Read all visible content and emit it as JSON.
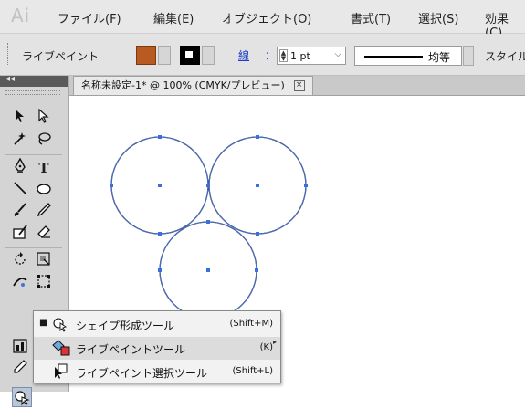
{
  "app": {
    "logo": "Ai"
  },
  "menu": [
    "ファイル(F)",
    "編集(E)",
    "オブジェクト(O)",
    "書式(T)",
    "選択(S)",
    "効果(C)"
  ],
  "control_bar": {
    "label": "ライブペイント",
    "fill_color": "#b85a22",
    "stroke_link": "線",
    "stroke_colon": "：",
    "stroke_weight": "1 pt",
    "profile_label": "均等",
    "style_label": "スタイル"
  },
  "document": {
    "tab_title": "名称未設定-1* @ 100% (CMYK/プレビュー)",
    "close_glyph": "×"
  },
  "colors": {
    "selection_path": "#4a72d4",
    "anchor_point": "#3a6fe0",
    "artwork_stroke": "#222222"
  },
  "flyout": {
    "items": [
      {
        "checked": true,
        "icon": "shape-builder-icon",
        "label": "シェイプ形成ツール",
        "shortcut": "(Shift+M)"
      },
      {
        "checked": false,
        "icon": "live-paint-bucket-icon",
        "label": "ライブペイントツール",
        "shortcut": "(K)"
      },
      {
        "checked": false,
        "icon": "live-paint-selection-icon",
        "label": "ライブペイント選択ツール",
        "shortcut": "(Shift+L)"
      }
    ],
    "check_glyph": "■",
    "tearoff_glyph": "▸"
  }
}
